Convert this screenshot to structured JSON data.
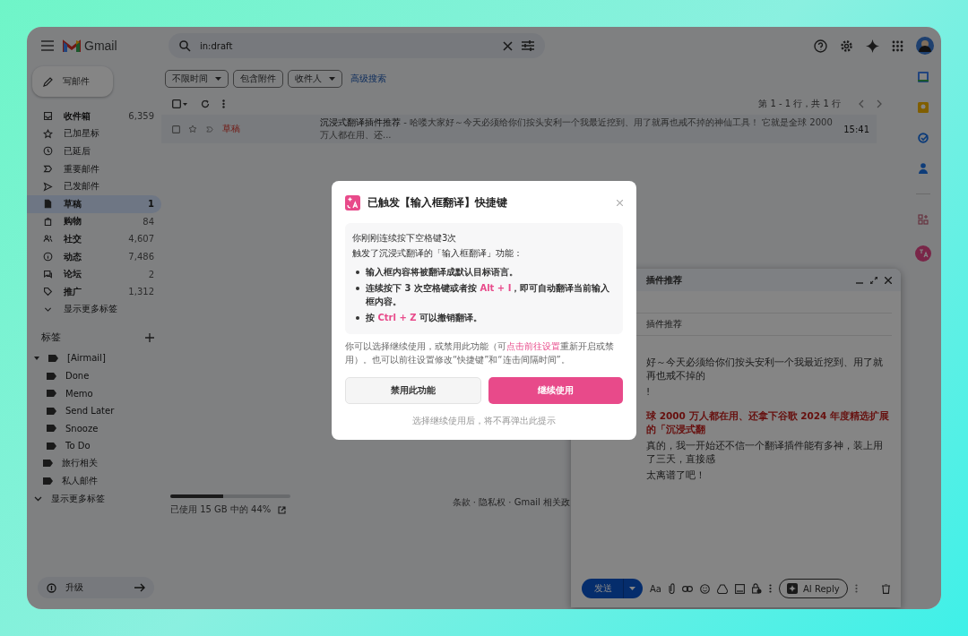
{
  "header": {
    "app_name": "Gmail",
    "search_value": "in:draft"
  },
  "compose_button": "写邮件",
  "sidebar": {
    "items": [
      {
        "kind": "inbox",
        "label": "收件箱",
        "count": "6,359",
        "unread": true,
        "selected": false
      },
      {
        "kind": "starred",
        "label": "已加星标",
        "unread": false,
        "selected": false
      },
      {
        "kind": "snoozed",
        "label": "已延后",
        "unread": false,
        "selected": false
      },
      {
        "kind": "important",
        "label": "重要邮件",
        "unread": false,
        "selected": false
      },
      {
        "kind": "sent",
        "label": "已发邮件",
        "unread": false,
        "selected": false
      },
      {
        "kind": "drafts",
        "label": "草稿",
        "count": "1",
        "unread": true,
        "selected": true
      },
      {
        "kind": "purchases",
        "label": "购物",
        "count": "84",
        "unread": true,
        "selected": false
      },
      {
        "kind": "social",
        "label": "社交",
        "count": "4,607",
        "unread": true,
        "selected": false
      },
      {
        "kind": "updates",
        "label": "动态",
        "count": "7,486",
        "unread": true,
        "selected": false
      },
      {
        "kind": "forums",
        "label": "论坛",
        "count": "2",
        "unread": true,
        "selected": false
      },
      {
        "kind": "promotions",
        "label": "推广",
        "count": "1,312",
        "unread": true,
        "selected": false
      },
      {
        "kind": "more",
        "label": "显示更多标签",
        "unread": false,
        "selected": false
      }
    ],
    "labels_title": "标签",
    "labels": [
      {
        "label": "[Airmail]",
        "expanded": true,
        "children": [
          {
            "label": "Done"
          },
          {
            "label": "Memo"
          },
          {
            "label": "Send Later"
          },
          {
            "label": "Snooze"
          },
          {
            "label": "To Do"
          }
        ]
      },
      {
        "label": "旅行相关"
      },
      {
        "label": "私人邮件"
      }
    ],
    "labels_more": "显示更多标签",
    "upgrade": "升级"
  },
  "filters": {
    "chips": [
      {
        "label": "不限时间",
        "dropdown": true
      },
      {
        "label": "包含附件",
        "dropdown": false
      },
      {
        "label": "收件人",
        "dropdown": true
      }
    ],
    "advanced": "高级搜索"
  },
  "list": {
    "pagination": "第 1 - 1 行，共 1 行",
    "rows": [
      {
        "label": "草稿",
        "subject": "沉浸式翻译插件推荐",
        "snippet": " - 哈喽大家好～今天必须给你们按头安利一个我最近挖到、用了就再也戒不掉的神仙工具！ 它就是全球 2000 万人都在用、还...",
        "time": "15:41"
      }
    ]
  },
  "storage": {
    "level": 0.44,
    "text": "已使用 15 GB 中的 44%"
  },
  "footer_links": "条款 · 隐私权 · Gmail 相关政",
  "compose": {
    "title": "插件推荐",
    "subject": "插件推荐",
    "body": [
      {
        "kind": "plain",
        "text": "好～今天必须给你们按头安利一个我最近挖到、用了就再也戒不掉的"
      },
      {
        "kind": "plain",
        "text": "!"
      },
      {
        "kind": "highlight",
        "text": "球 2000 万人都在用、还拿下谷歌 2024 年度精选扩展的「沉浸式翻"
      },
      {
        "kind": "plain",
        "text": "真的，我一开始还不信一个翻译插件能有多神，装上用了三天，直接感"
      },
      {
        "kind": "plain",
        "text": "太离谱了吧！"
      }
    ],
    "send": "发送",
    "format": "Aa",
    "ai_reply": "AI Reply"
  },
  "dialog": {
    "title": "已触发【输入框翻译】快捷键",
    "intro": [
      "你刚刚连续按下空格键3次",
      "触发了沉浸式翻译的「输入框翻译」功能："
    ],
    "bullets": [
      "输入框内容将被翻译成默认目标语言。",
      "连续按下 3 次空格键或者按 **Alt + I**，即可自动翻译当前输入框内容。",
      "按 **Ctrl + Z** 可以撤销翻译。"
    ],
    "note_before": "你可以选择继续使用，或禁用此功能（可",
    "note_link": "点击前往设置",
    "note_after": "重新开启或禁用）。也可以前往设置修改“快捷键”和“连击间隔时间”。",
    "disable": "禁用此功能",
    "continue": "继续使用",
    "footnote": "选择继续使用后，将不再弹出此提示"
  }
}
